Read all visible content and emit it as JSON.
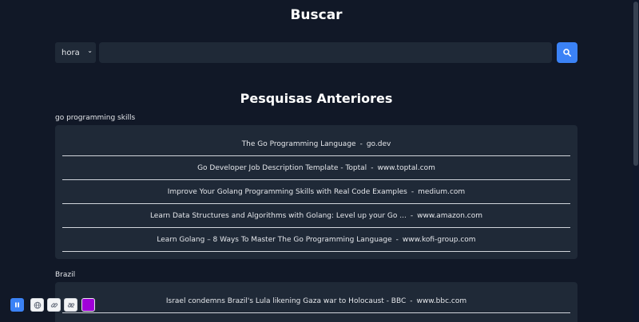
{
  "header": {
    "title": "Buscar"
  },
  "search": {
    "select_value": "hora",
    "input_value": "",
    "input_placeholder": ""
  },
  "history": {
    "title": "Pesquisas Anteriores",
    "groups": [
      {
        "label": "go programming skills",
        "results": [
          {
            "title": "The Go Programming Language",
            "sep": "-",
            "domain": "go.dev"
          },
          {
            "title": "Go Developer Job Description Template - Toptal",
            "sep": "-",
            "domain": "www.toptal.com"
          },
          {
            "title": "Improve Your Golang Programming Skills with Real Code Examples",
            "sep": "-",
            "domain": "medium.com"
          },
          {
            "title": "Learn Data Structures and Algorithms with Golang: Level up your Go ...",
            "sep": "-",
            "domain": "www.amazon.com"
          },
          {
            "title": "Learn Golang – 8 Ways To Master The Go Programming Language",
            "sep": "-",
            "domain": "www.kofi-group.com"
          }
        ]
      },
      {
        "label": "Brazil",
        "results": [
          {
            "title": "Israel condemns Brazil's Lula likening Gaza war to Holocaust - BBC",
            "sep": "-",
            "domain": "www.bbc.com"
          }
        ]
      }
    ]
  },
  "toolbar": {
    "icons": [
      "pause-icon",
      "globe-icon",
      "link-icon",
      "chain-icon",
      "color-swatch"
    ],
    "accent_color": "#3b82f6",
    "swatch_color": "#a000d8"
  },
  "colors": {
    "background": "#111827",
    "card": "#1f2937",
    "accent": "#3b82f6"
  }
}
